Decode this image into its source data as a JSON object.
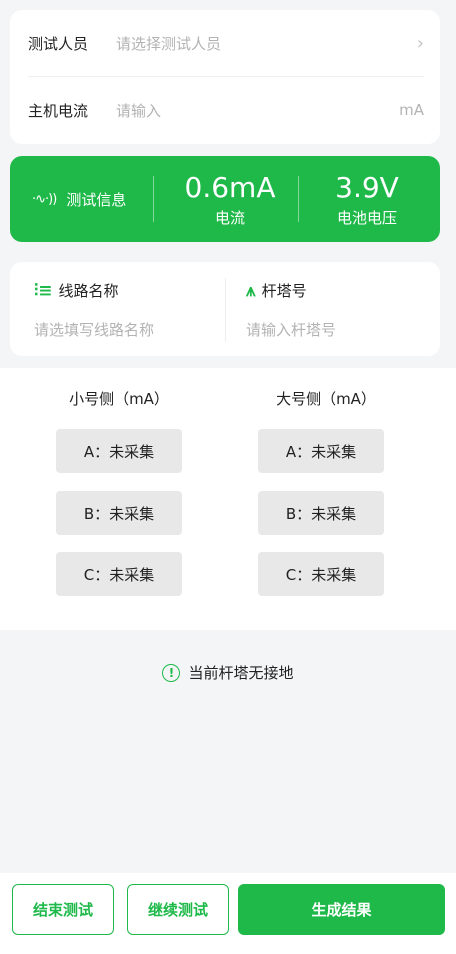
{
  "form": {
    "tester_label": "测试人员",
    "tester_placeholder": "请选择测试人员",
    "current_label": "主机电流",
    "current_placeholder": "请输入",
    "current_unit": "mA"
  },
  "info": {
    "label": "测试信息",
    "signal_icon": "signal-waves-icon",
    "current_value": "0.6mA",
    "current_caption": "电流",
    "voltage_value": "3.9V",
    "voltage_caption": "电池电压"
  },
  "line": {
    "name_label": "线路名称",
    "name_placeholder": "请选填写线路名称",
    "tower_label": "杆塔号",
    "tower_placeholder": "请输入杆塔号"
  },
  "sample": {
    "small_head": "小号侧（mA）",
    "large_head": "大号侧（mA）",
    "small": [
      "A：未采集",
      "B：未采集",
      "C：未采集"
    ],
    "large": [
      "A：未采集",
      "B：未采集",
      "C：未采集"
    ]
  },
  "warning": {
    "text": "当前杆塔无接地"
  },
  "actions": {
    "end_label": "结束测试",
    "continue_label": "继续测试",
    "generate_label": "生成结果"
  },
  "colors": {
    "accent": "#1fb94a",
    "background": "#f4f5f7",
    "chip": "#e8e8e8"
  }
}
